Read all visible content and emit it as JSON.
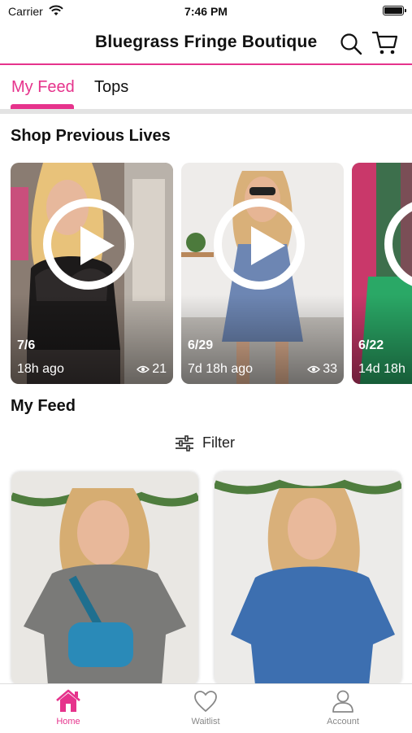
{
  "status_bar": {
    "carrier": "Carrier",
    "time": "7:46 PM"
  },
  "header": {
    "title": "Bluegrass Fringe Boutique"
  },
  "tabs": [
    {
      "label": "My Feed",
      "active": true
    },
    {
      "label": "Tops",
      "active": false
    }
  ],
  "previous_lives": {
    "title": "Shop Previous Lives",
    "items": [
      {
        "date": "7/6",
        "ago": "18h ago",
        "views": "21"
      },
      {
        "date": "6/29",
        "ago": "7d 18h ago",
        "views": "33"
      },
      {
        "date": "6/22",
        "ago": "14d 18h",
        "views": ""
      }
    ]
  },
  "feed": {
    "title": "My Feed",
    "filter_label": "Filter"
  },
  "bottom_nav": [
    {
      "label": "Home",
      "icon": "home-icon",
      "active": true
    },
    {
      "label": "Waitlist",
      "icon": "heart-icon",
      "active": false
    },
    {
      "label": "Account",
      "icon": "person-icon",
      "active": false
    }
  ],
  "colors": {
    "accent": "#e6338c"
  }
}
